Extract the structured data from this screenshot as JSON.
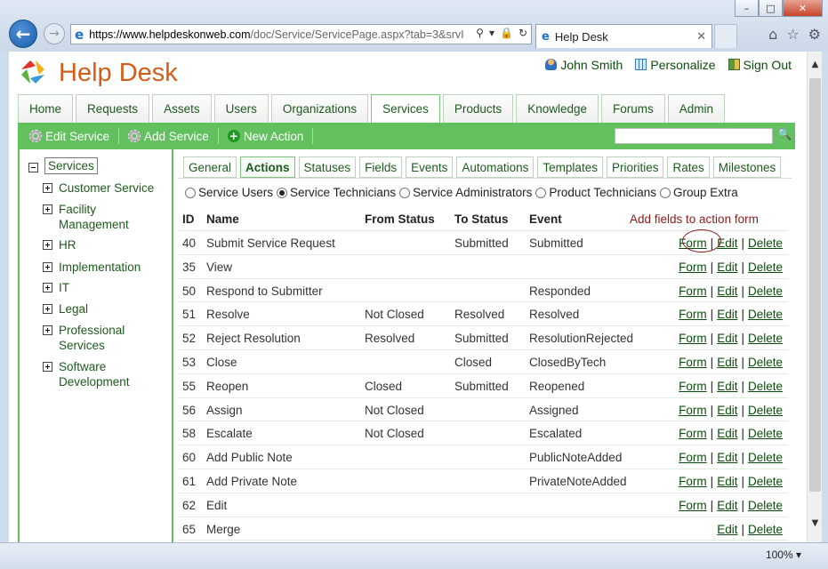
{
  "browser": {
    "url_host": "https://www.helpdeskonweb.com",
    "url_rest": "/doc/Service/ServicePage.aspx?tab=3&srvI",
    "tab_title": "Help Desk",
    "zoom": "100%"
  },
  "app": {
    "title": "Help Desk",
    "user_name": "John Smith",
    "personalize": "Personalize",
    "sign_out": "Sign Out"
  },
  "main_tabs": [
    "Home",
    "Requests",
    "Assets",
    "Users",
    "Organizations",
    "Services",
    "Products",
    "Knowledge",
    "Forums",
    "Admin"
  ],
  "main_tab_active": "Services",
  "toolbar": {
    "edit_service": "Edit Service",
    "add_service": "Add Service",
    "new_action": "New Action",
    "search_value": ""
  },
  "tree": {
    "root": "Services",
    "items": [
      "Customer Service",
      "Facility Management",
      "HR",
      "Implementation",
      "IT",
      "Legal",
      "Professional Services",
      "Software Development"
    ]
  },
  "sub_tabs": [
    "General",
    "Actions",
    "Statuses",
    "Fields",
    "Events",
    "Automations",
    "Templates",
    "Priorities",
    "Rates",
    "Milestones"
  ],
  "sub_tab_active": "Actions",
  "radios": {
    "options": [
      "Service Users",
      "Service Technicians",
      "Service Administrators",
      "Product Technicians",
      "Group Extra"
    ],
    "selected": "Service Technicians"
  },
  "table": {
    "headers": {
      "id": "ID",
      "name": "Name",
      "from": "From Status",
      "to": "To Status",
      "event": "Event"
    },
    "annotation": "Add fields to action form",
    "link_form": "Form",
    "link_edit": "Edit",
    "link_delete": "Delete",
    "separator": "|",
    "rows": [
      {
        "id": "40",
        "name": "Submit Service Request",
        "from": "",
        "to": "Submitted",
        "event": "Submitted",
        "form": true
      },
      {
        "id": "35",
        "name": "View",
        "from": "",
        "to": "",
        "event": "",
        "form": true
      },
      {
        "id": "50",
        "name": "Respond to Submitter",
        "from": "",
        "to": "",
        "event": "Responded",
        "form": true
      },
      {
        "id": "51",
        "name": "Resolve",
        "from": "Not Closed",
        "to": "Resolved",
        "event": "Resolved",
        "form": true
      },
      {
        "id": "52",
        "name": "Reject Resolution",
        "from": "Resolved",
        "to": "Submitted",
        "event": "ResolutionRejected",
        "form": true
      },
      {
        "id": "53",
        "name": "Close",
        "from": "",
        "to": "Closed",
        "event": "ClosedByTech",
        "form": true
      },
      {
        "id": "55",
        "name": "Reopen",
        "from": "Closed",
        "to": "Submitted",
        "event": "Reopened",
        "form": true
      },
      {
        "id": "56",
        "name": "Assign",
        "from": "Not Closed",
        "to": "",
        "event": "Assigned",
        "form": true
      },
      {
        "id": "58",
        "name": "Escalate",
        "from": "Not Closed",
        "to": "",
        "event": "Escalated",
        "form": true
      },
      {
        "id": "60",
        "name": "Add Public Note",
        "from": "",
        "to": "",
        "event": "PublicNoteAdded",
        "form": true
      },
      {
        "id": "61",
        "name": "Add Private Note",
        "from": "",
        "to": "",
        "event": "PrivateNoteAdded",
        "form": true
      },
      {
        "id": "62",
        "name": "Edit",
        "from": "",
        "to": "",
        "event": "",
        "form": true
      },
      {
        "id": "65",
        "name": "Merge",
        "from": "",
        "to": "",
        "event": "",
        "form": false
      }
    ]
  }
}
